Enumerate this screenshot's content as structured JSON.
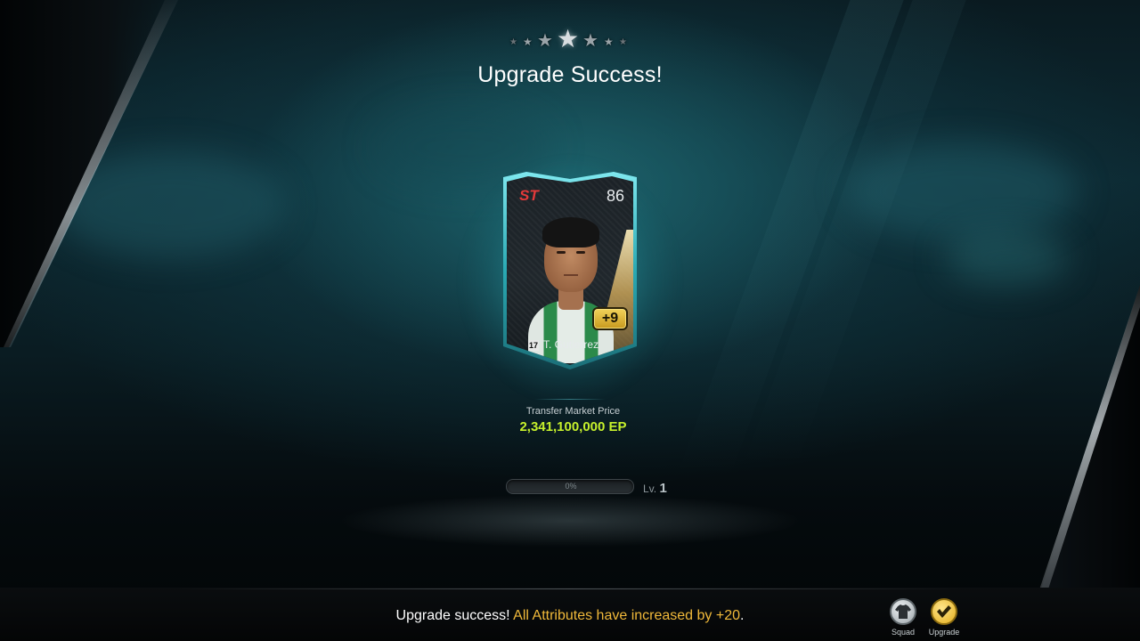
{
  "header": {
    "stars": {
      "filled": 3,
      "total": 7
    },
    "title": "Upgrade Success!"
  },
  "card": {
    "position": "ST",
    "rating": "86",
    "season_badge": "17",
    "player_name": "T. Gutierrez",
    "upgrade_level": "+9",
    "colors": {
      "position": "#e23a3a",
      "glow": "#3cd2dc",
      "badge": "#f2d25a"
    }
  },
  "price": {
    "label": "Transfer Market Price",
    "value": "2,341,100,000 EP",
    "color": "#c6f02c"
  },
  "level": {
    "progress_text": "0%",
    "progress": 0,
    "label": "Lv.",
    "value": "1"
  },
  "footer": {
    "message_prefix": "Upgrade success! ",
    "message_highlight": "All Attributes have increased by +20",
    "message_suffix": ".",
    "highlight_color": "#f0b93a",
    "buttons": [
      {
        "label": "Squad",
        "icon": "squad-shirt-icon"
      },
      {
        "label": "Upgrade",
        "icon": "checkmark-icon"
      }
    ]
  }
}
